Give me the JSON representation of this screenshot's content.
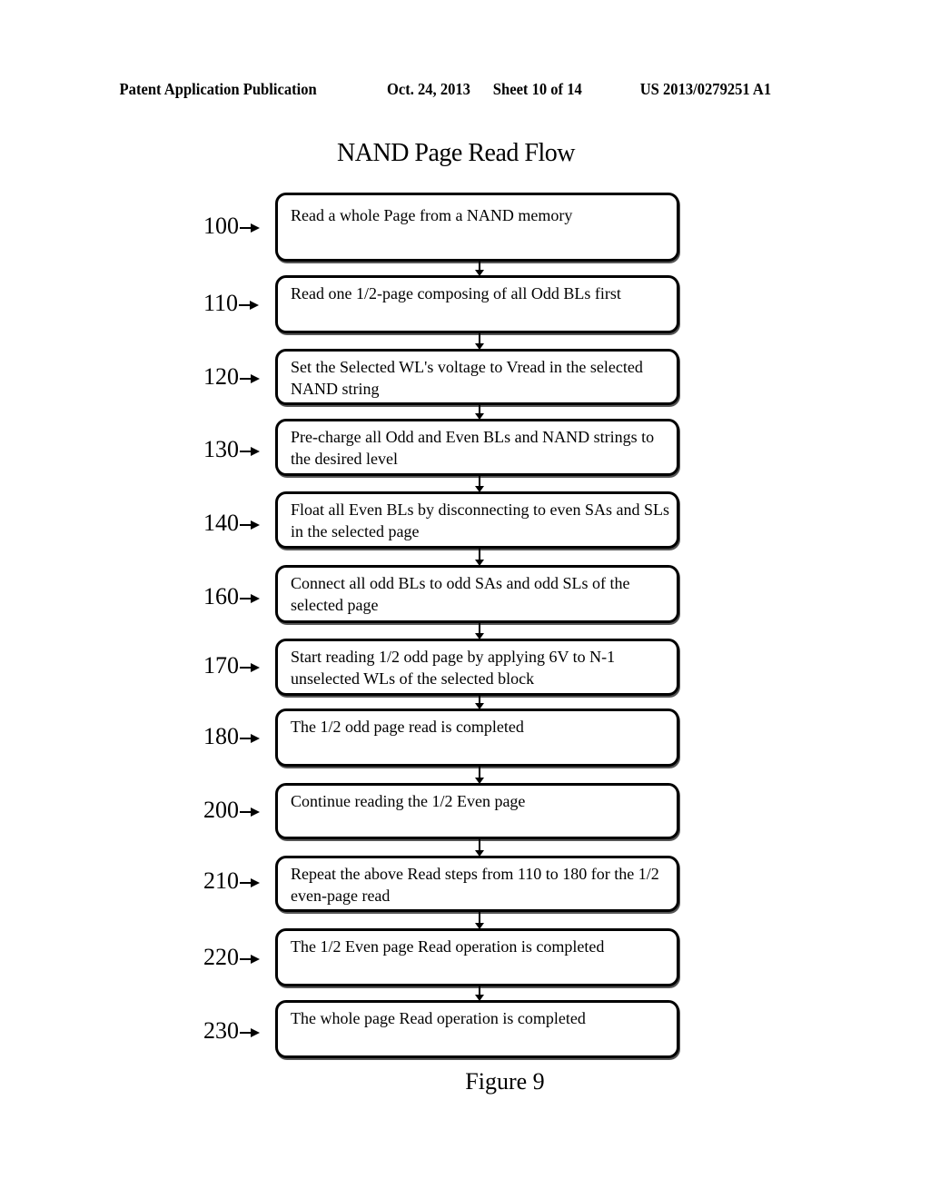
{
  "header": {
    "publication": "Patent Application Publication",
    "date": "Oct. 24, 2013",
    "sheet": "Sheet 10 of 14",
    "number": "US 2013/0279251 A1"
  },
  "title": "NAND Page Read Flow",
  "steps": [
    {
      "ref": "100",
      "text": "Read a whole Page from a NAND memory"
    },
    {
      "ref": "110",
      "text": "Read one 1/2-page composing of all Odd BLs first"
    },
    {
      "ref": "120",
      "text": "Set the Selected WL's voltage to Vread in the selected NAND string"
    },
    {
      "ref": "130",
      "text": "Pre-charge all Odd and Even BLs and NAND strings to the desired level"
    },
    {
      "ref": "140",
      "text": "Float all Even BLs by disconnecting to even SAs and SLs in the selected page"
    },
    {
      "ref": "160",
      "text": "Connect all odd BLs to odd SAs and odd SLs of the selected page"
    },
    {
      "ref": "170",
      "text": "Start reading 1/2 odd page by applying 6V to N-1 unselected WLs of the selected block"
    },
    {
      "ref": "180",
      "text": "The 1/2 odd page read is completed"
    },
    {
      "ref": "200",
      "text": "Continue reading the 1/2 Even page"
    },
    {
      "ref": "210",
      "text": "Repeat the above Read steps from 110 to 180 for the 1/2 even-page read"
    },
    {
      "ref": "220",
      "text": "The 1/2 Even page Read operation is completed"
    },
    {
      "ref": "230",
      "text": "The whole page Read operation is completed"
    }
  ],
  "figure_label": "Figure 9"
}
